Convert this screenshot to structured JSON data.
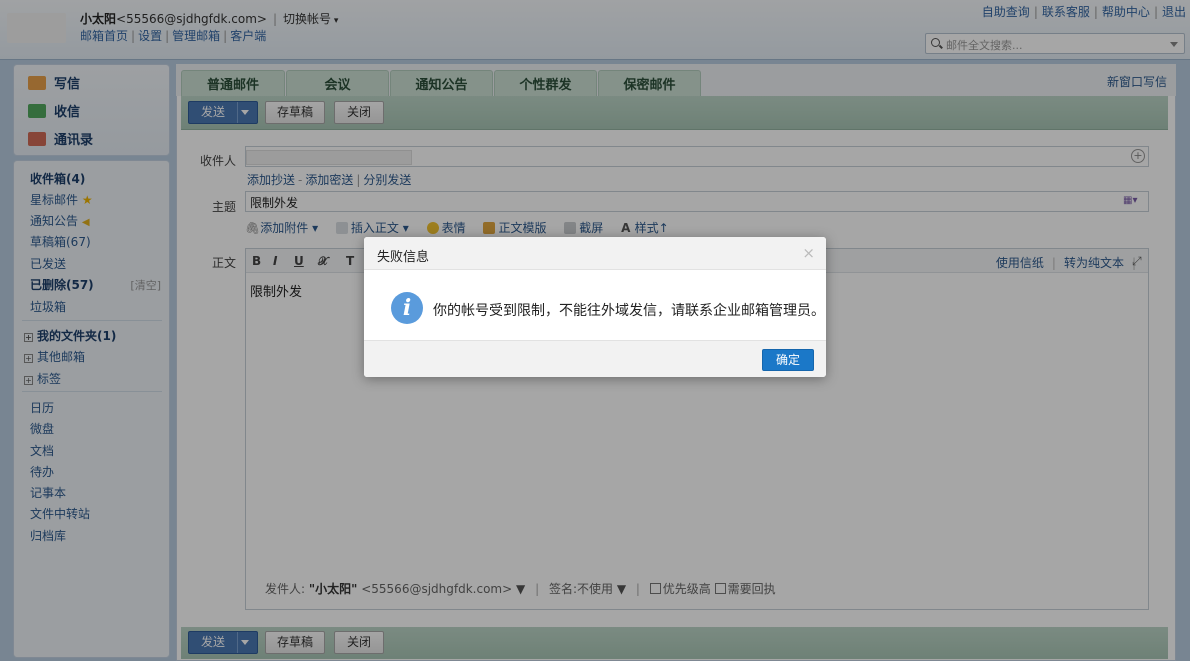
{
  "header": {
    "user_name": "小太阳",
    "user_email": "<55566@sjdhgfdk.com>",
    "switch_account": "切换帐号",
    "nav_links": [
      "邮箱首页",
      "设置",
      "管理邮箱",
      "客户端"
    ],
    "top_links": [
      "自助查询",
      "联系客服",
      "帮助中心",
      "退出"
    ],
    "search_placeholder": "邮件全文搜索..."
  },
  "sidebar": {
    "quick": [
      {
        "label": "写信",
        "icon": "pen-icon",
        "color": "#e08a2a"
      },
      {
        "label": "收信",
        "icon": "inbox-download-icon",
        "color": "#3c9a4a"
      },
      {
        "label": "通讯录",
        "icon": "contacts-icon",
        "color": "#c95b48"
      }
    ],
    "folders": {
      "inbox": "收件箱(4)",
      "starred": "星标邮件",
      "notice": "通知公告",
      "drafts": "草稿箱(67)",
      "sent": "已发送",
      "deleted": "已删除(57)",
      "clear": "[清空]",
      "spam": "垃圾箱",
      "my_folders": "我的文件夹(1)",
      "other_mail": "其他邮箱",
      "tags": "标签"
    },
    "apps": [
      "日历",
      "微盘",
      "文档",
      "待办",
      "记事本",
      "文件中转站",
      "归档库"
    ]
  },
  "tabs": [
    "普通邮件",
    "会议",
    "通知公告",
    "个性群发",
    "保密邮件"
  ],
  "new_window_compose": "新窗口写信",
  "toolbar": {
    "send": "发送",
    "save_draft": "存草稿",
    "close": "关闭"
  },
  "compose": {
    "to_label": "收件人",
    "add_links": [
      "添加抄送",
      "添加密送",
      "分别发送"
    ],
    "subject_label": "主题",
    "subject_value": "限制外发",
    "tools": [
      "添加附件",
      "插入正文",
      "表情",
      "正文模版",
      "截屏",
      "样式↑"
    ],
    "body_label": "正文",
    "format_buttons": [
      "B",
      "I",
      "U",
      "𝒳",
      "T"
    ],
    "use_stationery": "使用信纸",
    "to_plain_text": "转为纯文本",
    "body_text": "限制外发",
    "footer": {
      "sender_label": "发件人:",
      "sender_name": "\"小太阳\"",
      "sender_email": "<55566@sjdhgfdk.com>",
      "signature_label": "签名:",
      "signature_value": "不使用",
      "priority": "优先级高",
      "receipt": "需要回执"
    }
  },
  "dialog": {
    "title": "失败信息",
    "close": "×",
    "message": "你的帐号受到限制，不能往外域发信，请联系企业邮箱管理员。",
    "ok": "确定",
    "icon": "info-icon"
  }
}
